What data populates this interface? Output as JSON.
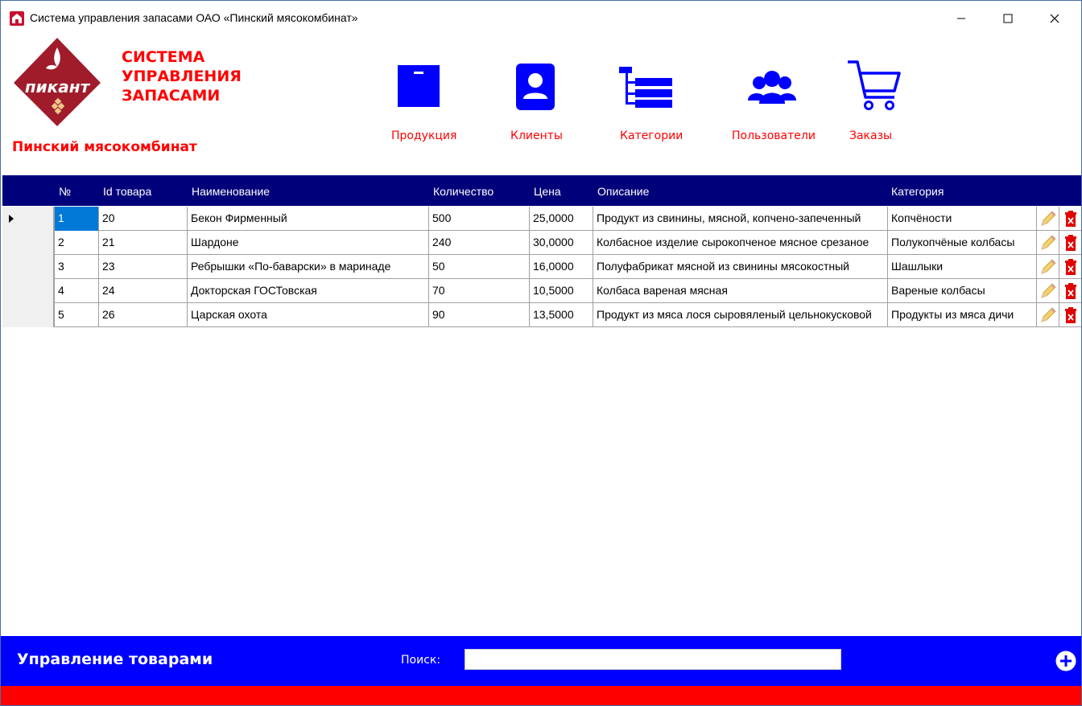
{
  "window": {
    "title": "Система управления запасами ОАО «Пинский мясокомбинат»"
  },
  "header": {
    "logo_text": "пикант",
    "brand_lines": [
      "СИСТЕМА",
      "УПРАВЛЕНИЯ",
      "ЗАПАСАМИ"
    ],
    "company": "Пинский мясокомбинат",
    "nav": [
      {
        "label": "Продукция",
        "icon": "box-icon"
      },
      {
        "label": "Клиенты",
        "icon": "contact-card-icon"
      },
      {
        "label": "Категории",
        "icon": "tree-list-icon"
      },
      {
        "label": "Пользователи",
        "icon": "users-icon"
      },
      {
        "label": "Заказы",
        "icon": "cart-icon"
      }
    ]
  },
  "table": {
    "columns": [
      "№",
      "Id товара",
      "Наименование",
      "Количество",
      "Цена",
      "Описание",
      "Категория"
    ],
    "rows": [
      {
        "no": "1",
        "id": "20",
        "name": "Бекон Фирменный",
        "qty": "500",
        "price": "25,0000",
        "desc": "Продукт из свинины, мясной, копчено-запеченный",
        "cat": "Копчёности"
      },
      {
        "no": "2",
        "id": "21",
        "name": "Шардоне",
        "qty": "240",
        "price": "30,0000",
        "desc": "Колбасное изделие сырокопченое мясное срезаное",
        "cat": "Полукопчёные колбасы"
      },
      {
        "no": "3",
        "id": "23",
        "name": "Ребрышки «По-баварски» в маринаде",
        "qty": "50",
        "price": "16,0000",
        "desc": "Полуфабрикат мясной из свинины мясокостный",
        "cat": "Шашлыки"
      },
      {
        "no": "4",
        "id": "24",
        "name": "Докторская ГОСТовская",
        "qty": "70",
        "price": "10,5000",
        "desc": "Колбаса вареная мясная",
        "cat": "Вареные колбасы"
      },
      {
        "no": "5",
        "id": "26",
        "name": "Царская охота",
        "qty": "90",
        "price": "13,5000",
        "desc": "Продукт из мяса лося сыровяленый цельнокусковой",
        "cat": "Продукты из мяса дичи"
      }
    ],
    "selected_row": 0
  },
  "footer": {
    "title": "Управление товарами",
    "search_label": "Поиск:",
    "search_value": ""
  },
  "colors": {
    "accent_blue": "#0000ff",
    "header_navy": "#00007a",
    "brand_red": "#ff0000",
    "logo_maroon": "#a01c2a"
  }
}
